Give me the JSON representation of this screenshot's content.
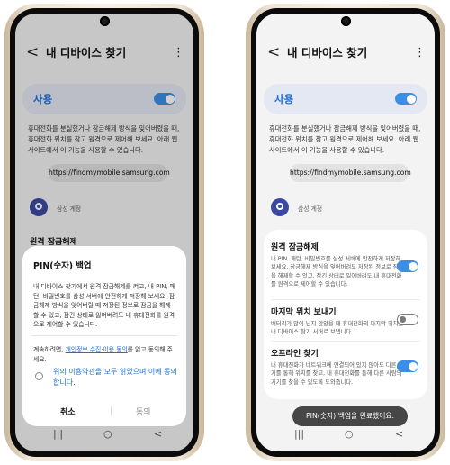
{
  "left": {
    "header": {
      "back": "<",
      "title": "내 디바이스 찾기",
      "more": "⋮"
    },
    "use": {
      "label": "사용",
      "on": true
    },
    "description": "휴대전화를 분실했거나 잠금해제 방식을 잊어버렸을 때, 휴대전화 위치를 찾고 원격으로 제어해 보세요. 아래 웹사이트에서 이 기능을 사용할 수 있습니다.",
    "url": "https://findmymobile.samsung.com",
    "account_label": "삼성 계정",
    "partial_heading": "원격 잠금해제",
    "dialog": {
      "title": "PIN(숫자) 백업",
      "body": "내 디바이스 찾기에서 원격 잠금해제를 켜고, 내 PIN, 패턴, 비밀번호를 삼성 서버에 안전하게 저장해 보세요. 잠금해제 방식을 잊어버릴 때 저장된 정보로 잠금을 해제할 수 있고, 잠긴 상태로 잃어버려도 내 휴대전화를 원격으로 제어할 수 있습니다.",
      "consent_prefix": "계속하려면, ",
      "consent_link": "개인정보 수집·이용 동의",
      "consent_suffix": "를 읽고 동의해 주세요.",
      "checkbox_label": "위의 이용약관을 모두 읽었으며 이에 동의합니다.",
      "cancel": "취소",
      "agree": "동의"
    },
    "nav": {
      "recents": "|||",
      "home": "○",
      "back": "<"
    }
  },
  "right": {
    "header": {
      "back": "<",
      "title": "내 디바이스 찾기",
      "more": "⋮"
    },
    "use": {
      "label": "사용",
      "on": true
    },
    "description": "휴대전화를 분실했거나 잠금해제 방식을 잊어버렸을 때, 휴대전화 위치를 찾고 원격으로 제어해 보세요. 아래 웹사이트에서 이 기능을 사용할 수 있습니다.",
    "url": "https://findmymobile.samsung.com",
    "account_label": "삼성 계정",
    "settings": [
      {
        "title": "원격 잠금해제",
        "desc": "내 PIN, 패턴, 비밀번호를 삼성 서버에 안전하게 저장해 보세요. 잠금해제 방식을 잊어버려도 저장된 정보로 잠금을 해제할 수 있고, 잠긴 상태로 잃어버려도 내 휴대전화를 원격으로 제어할 수 있습니다.",
        "on": true
      },
      {
        "title": "마지막 위치 보내기",
        "desc": "배터리가 많이 남지 않았을 때 휴대전화의 마지막 위치를 내 디바이스 찾기 서버로 보냅니다.",
        "on": false
      },
      {
        "title": "오프라인 찾기",
        "desc": "내 휴대전화가 네트워크에 연결되어 있지 않아도 다른 기기를 통해 위치를 찾고, 내 휴대전화를 통해 다른 사람의 기기를 찾을 수 있도록 도와줍니다.",
        "on": true
      }
    ],
    "toast": "PIN(숫자) 백업을 완료했어요.",
    "nav": {
      "recents": "|||",
      "home": "○",
      "back": "<"
    }
  },
  "colors": {
    "accent": "#3a8ee6",
    "use_card": "#e4e8f3",
    "device_frame": "#efe6d6"
  }
}
